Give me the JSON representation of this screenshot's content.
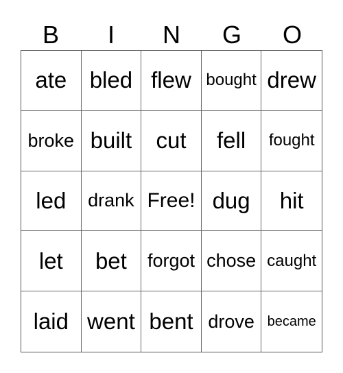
{
  "header": [
    "B",
    "I",
    "N",
    "G",
    "O"
  ],
  "rows": [
    [
      "ate",
      "bled",
      "flew",
      "bought",
      "drew"
    ],
    [
      "broke",
      "built",
      "cut",
      "fell",
      "fought"
    ],
    [
      "led",
      "drank",
      "Free!",
      "dug",
      "hit"
    ],
    [
      "let",
      "bet",
      "forgot",
      "chose",
      "caught"
    ],
    [
      "laid",
      "went",
      "bent",
      "drove",
      "became"
    ]
  ]
}
